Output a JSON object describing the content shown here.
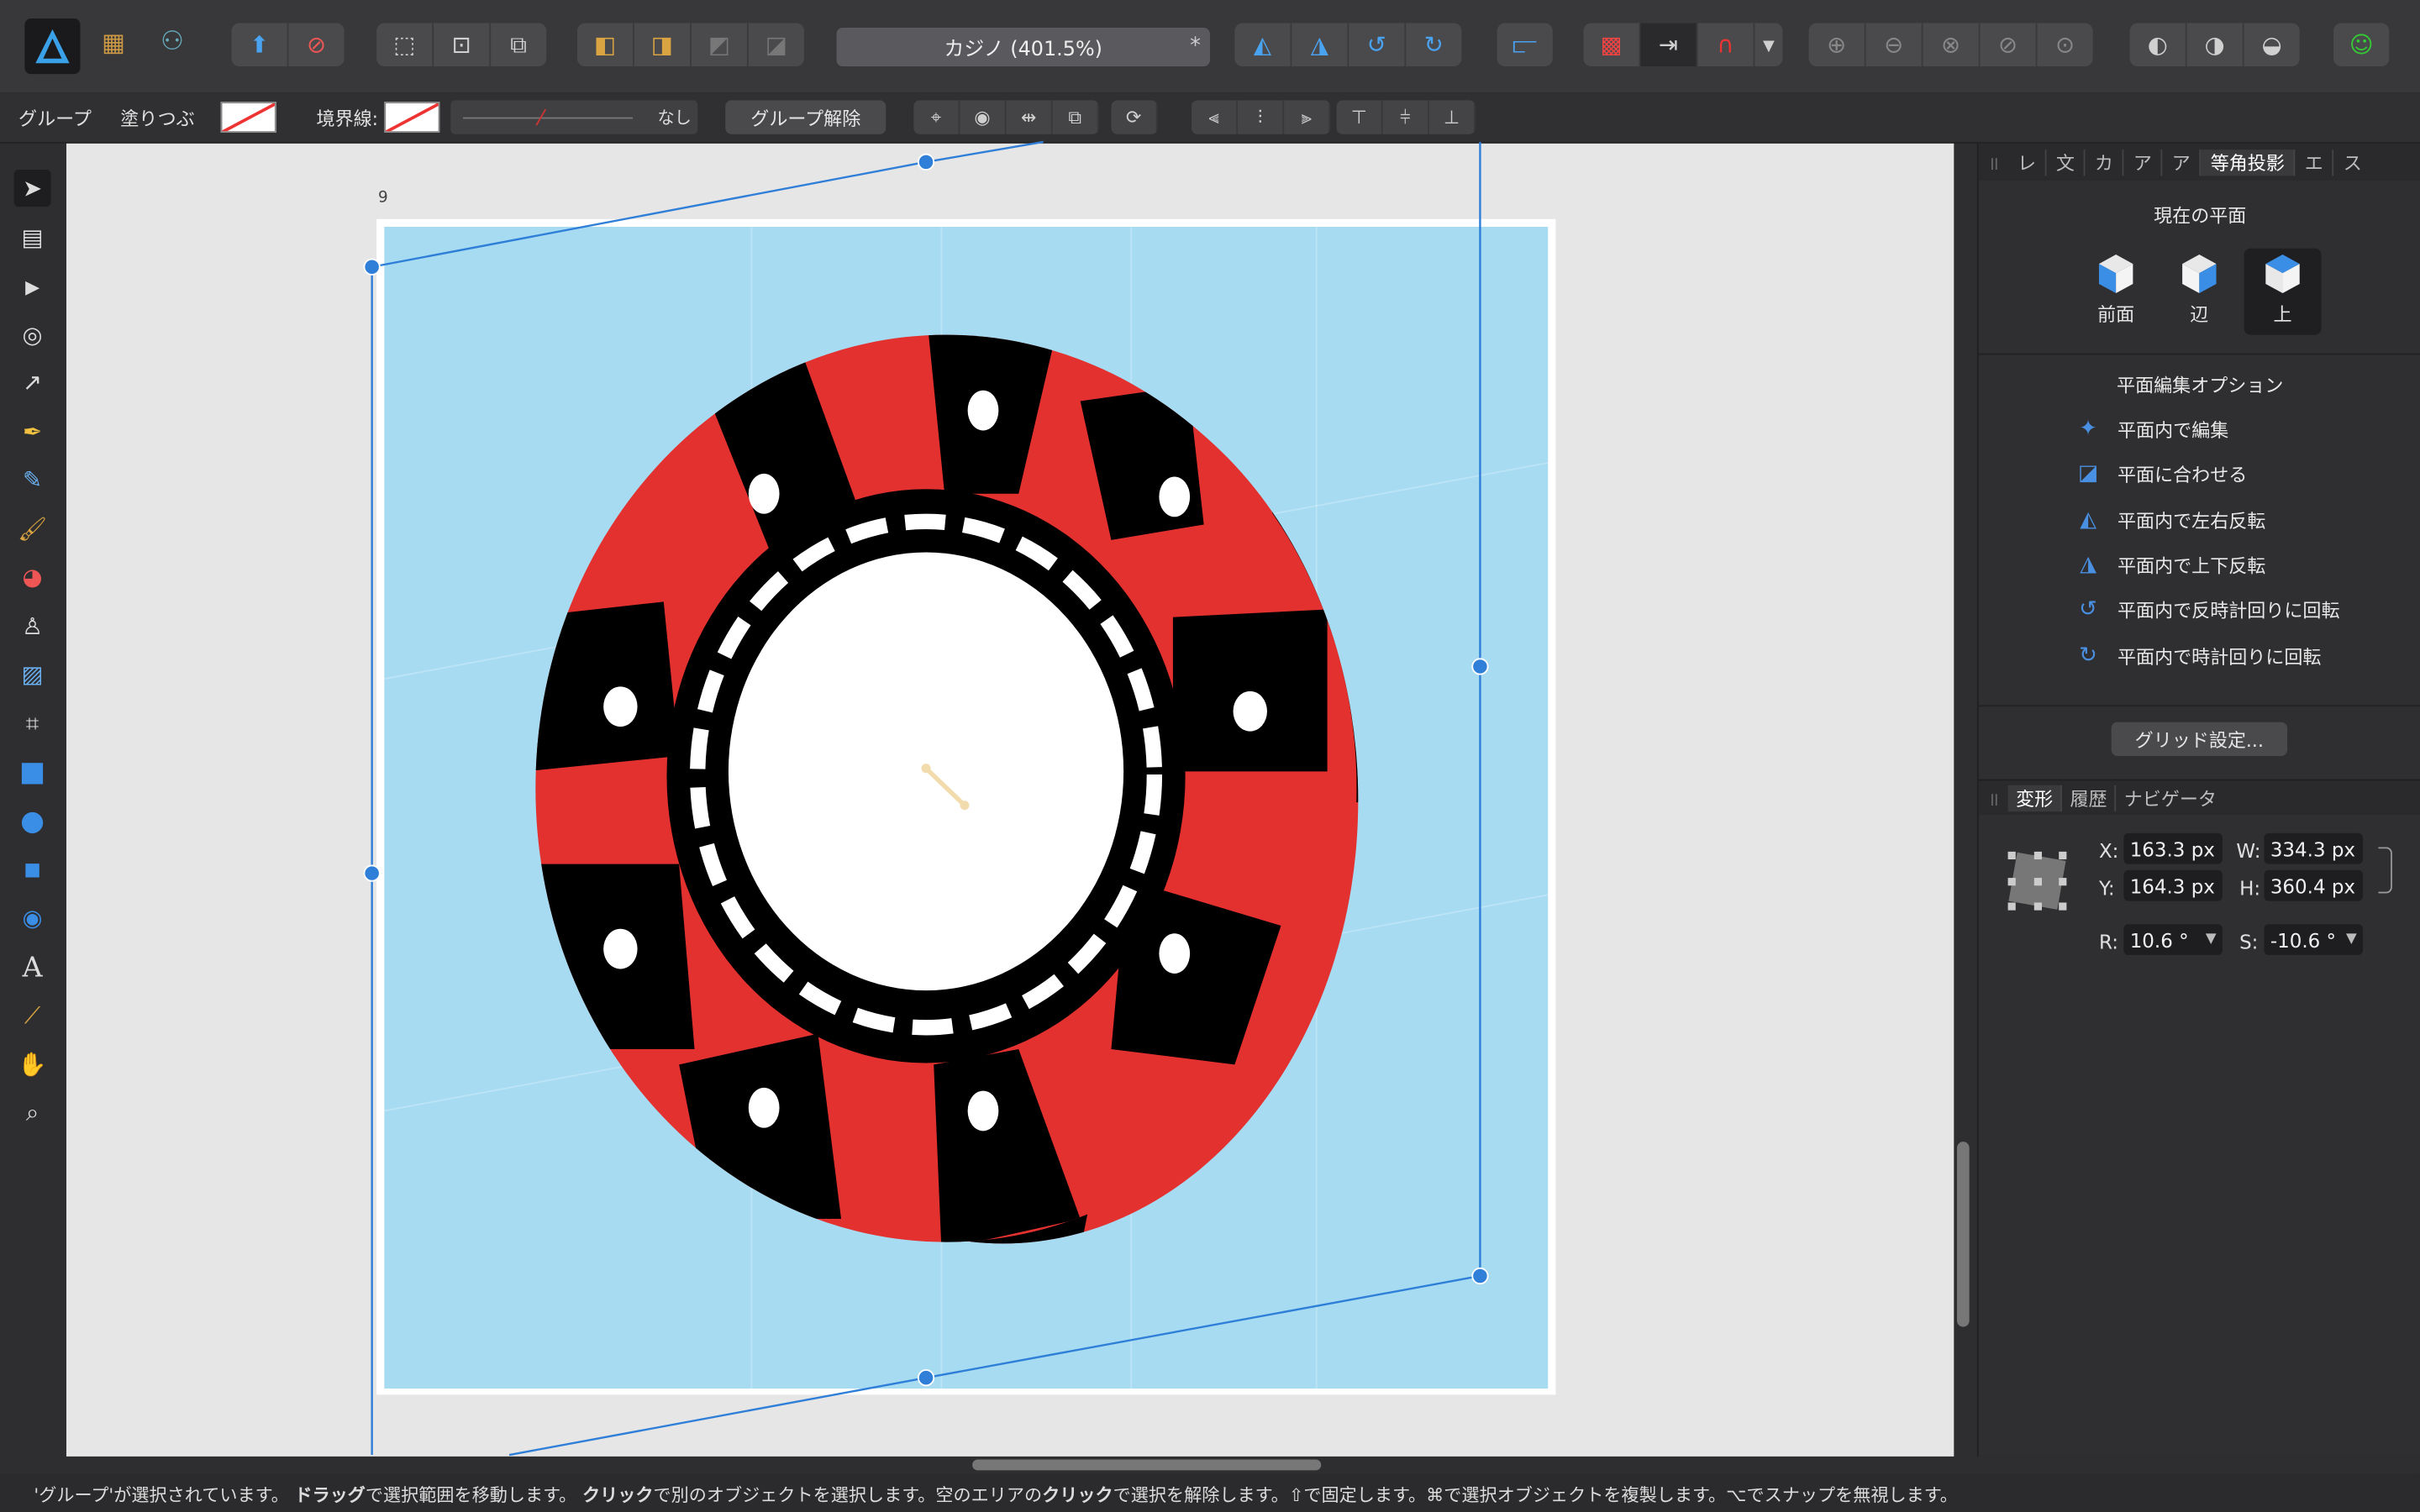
{
  "app": {
    "doc_title": "カジノ (401.5%)",
    "modified_mark": "*"
  },
  "context_bar": {
    "group_label": "グループ",
    "fill_label": "塗りつぶ",
    "stroke_label": "境界線:",
    "stroke_none": "なし",
    "ungroup_button": "グループ解除"
  },
  "canvas": {
    "page_number": "9"
  },
  "panel_tabs": [
    {
      "label": "レ"
    },
    {
      "label": "文"
    },
    {
      "label": "カ"
    },
    {
      "label": "ア"
    },
    {
      "label": "ア"
    },
    {
      "label": "等角投影"
    },
    {
      "label": "エ"
    },
    {
      "label": "ス"
    }
  ],
  "isometric": {
    "current_plane_title": "現在の平面",
    "planes": [
      {
        "label": "前面"
      },
      {
        "label": "辺"
      },
      {
        "label": "上"
      }
    ],
    "options_title": "平面編集オプション",
    "options": [
      {
        "label": "平面内で編集"
      },
      {
        "label": "平面に合わせる"
      },
      {
        "label": "平面内で左右反転"
      },
      {
        "label": "平面内で上下反転"
      },
      {
        "label": "平面内で反時計回りに回転"
      },
      {
        "label": "平面内で時計回りに回転"
      }
    ],
    "grid_button": "グリッド設定..."
  },
  "lower_tabs": [
    {
      "label": "変形"
    },
    {
      "label": "履歴"
    },
    {
      "label": "ナビゲータ"
    }
  ],
  "transform": {
    "x_label": "X:",
    "x_value": "163.3 px",
    "y_label": "Y:",
    "y_value": "164.3 px",
    "w_label": "W:",
    "w_value": "334.3 px",
    "h_label": "H:",
    "h_value": "360.4 px",
    "r_label": "R:",
    "r_value": "10.6 °",
    "s_label": "S:",
    "s_value": "-10.6 °"
  },
  "status": {
    "seg1": "'グループ'が選択されています。",
    "seg2_bold": "ドラッグ",
    "seg2": "で選択範囲を移動します。",
    "seg3_bold": "クリック",
    "seg3": "で別のオブジェクトを選択します。空のエリアの",
    "seg4_bold": "クリック",
    "seg4": "で選択を解除します。",
    "seg5": "⇧で固定します。⌘で選択オブジェクトを複製します。⌥でスナップを無視します。"
  },
  "colors": {
    "canvas_bg": "#a6dbf2",
    "chip_red": "#e3312f",
    "chip_black": "#000000",
    "selection_blue": "#2f7fd8"
  }
}
